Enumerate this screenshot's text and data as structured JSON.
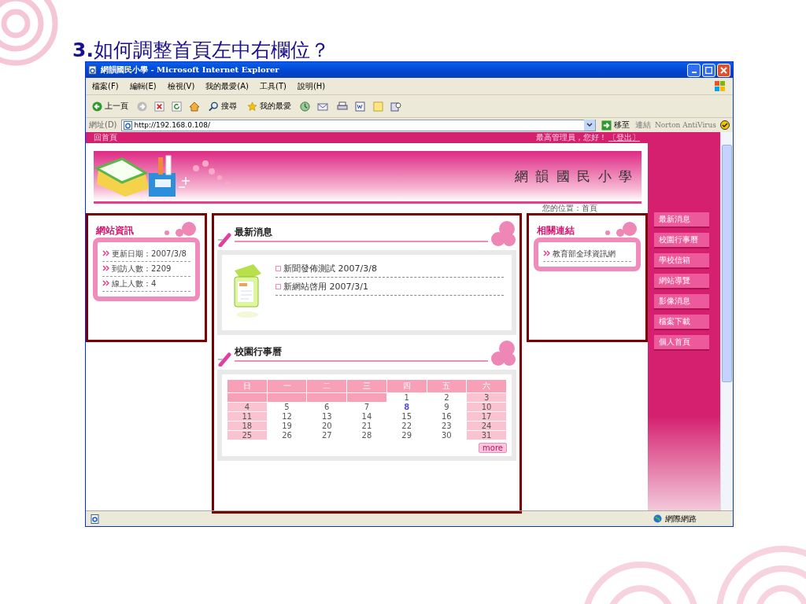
{
  "slide_title": "**3.**如何調整首頁左中右欄位？",
  "window": {
    "title": "網韻國民小學 - Microsoft Internet Explorer"
  },
  "menu": [
    "檔案(F)",
    "編輯(E)",
    "檢視(V)",
    "我的最愛(A)",
    "工具(T)",
    "說明(H)"
  ],
  "toolbar": {
    "back": "上一頁",
    "search": "搜尋",
    "favorites": "我的最愛"
  },
  "address_bar": {
    "label": "網址(D)",
    "url": "http://192.168.0.108/",
    "go": "移至",
    "links": "連結",
    "norton": "Norton AntiVirus"
  },
  "site": {
    "home_link": "回首頁",
    "greeting": "最高管理員，您好！",
    "logout": "〔登出〕",
    "school_name": "網 韻 國 民 小 學",
    "breadcrumb": "您的位置：首頁"
  },
  "left_panel": {
    "title": "網站資訊",
    "items": [
      "更新日期：2007/3/8",
      "到訪人數：2209",
      "線上人數：4"
    ]
  },
  "news": {
    "title": "最新消息",
    "items": [
      "新聞發佈測試 2007/3/8",
      "新網站啓用 2007/3/1"
    ]
  },
  "calendar": {
    "title": "校園行事曆",
    "weekdays": [
      "日",
      "一",
      "二",
      "三",
      "四",
      "五",
      "六"
    ],
    "weeks": [
      [
        {
          "kind": "blank"
        },
        {
          "kind": "blank"
        },
        {
          "kind": "blank"
        },
        {
          "kind": "blank"
        },
        {
          "kind": "day",
          "text": "1"
        },
        {
          "kind": "day",
          "text": "2"
        },
        {
          "kind": "day",
          "text": "3"
        }
      ],
      [
        {
          "kind": "day",
          "text": "4"
        },
        {
          "kind": "day",
          "text": "5"
        },
        {
          "kind": "day",
          "text": "6"
        },
        {
          "kind": "day",
          "text": "7"
        },
        {
          "kind": "today",
          "text": "8"
        },
        {
          "kind": "day",
          "text": "9"
        },
        {
          "kind": "day",
          "text": "10"
        }
      ],
      [
        {
          "kind": "day",
          "text": "11"
        },
        {
          "kind": "day",
          "text": "12"
        },
        {
          "kind": "day",
          "text": "13"
        },
        {
          "kind": "day",
          "text": "14"
        },
        {
          "kind": "day",
          "text": "15"
        },
        {
          "kind": "day",
          "text": "16"
        },
        {
          "kind": "day",
          "text": "17"
        }
      ],
      [
        {
          "kind": "day",
          "text": "18"
        },
        {
          "kind": "day",
          "text": "19"
        },
        {
          "kind": "day",
          "text": "20"
        },
        {
          "kind": "day",
          "text": "21"
        },
        {
          "kind": "day",
          "text": "22"
        },
        {
          "kind": "day",
          "text": "23"
        },
        {
          "kind": "day",
          "text": "24"
        }
      ],
      [
        {
          "kind": "day",
          "text": "25"
        },
        {
          "kind": "day",
          "text": "26"
        },
        {
          "kind": "day",
          "text": "27"
        },
        {
          "kind": "day",
          "text": "28"
        },
        {
          "kind": "day",
          "text": "29"
        },
        {
          "kind": "day",
          "text": "30"
        },
        {
          "kind": "day",
          "text": "31"
        }
      ]
    ],
    "more": "more"
  },
  "links_panel": {
    "title": "相關連結",
    "items": [
      "教育部全球資訊網"
    ]
  },
  "nav": [
    "最新消息",
    "校園行事曆",
    "學校信箱",
    "網站導覽",
    "影像消息",
    "檔案下載",
    "個人首頁"
  ],
  "status_bar": {
    "zone": "網際網路"
  }
}
